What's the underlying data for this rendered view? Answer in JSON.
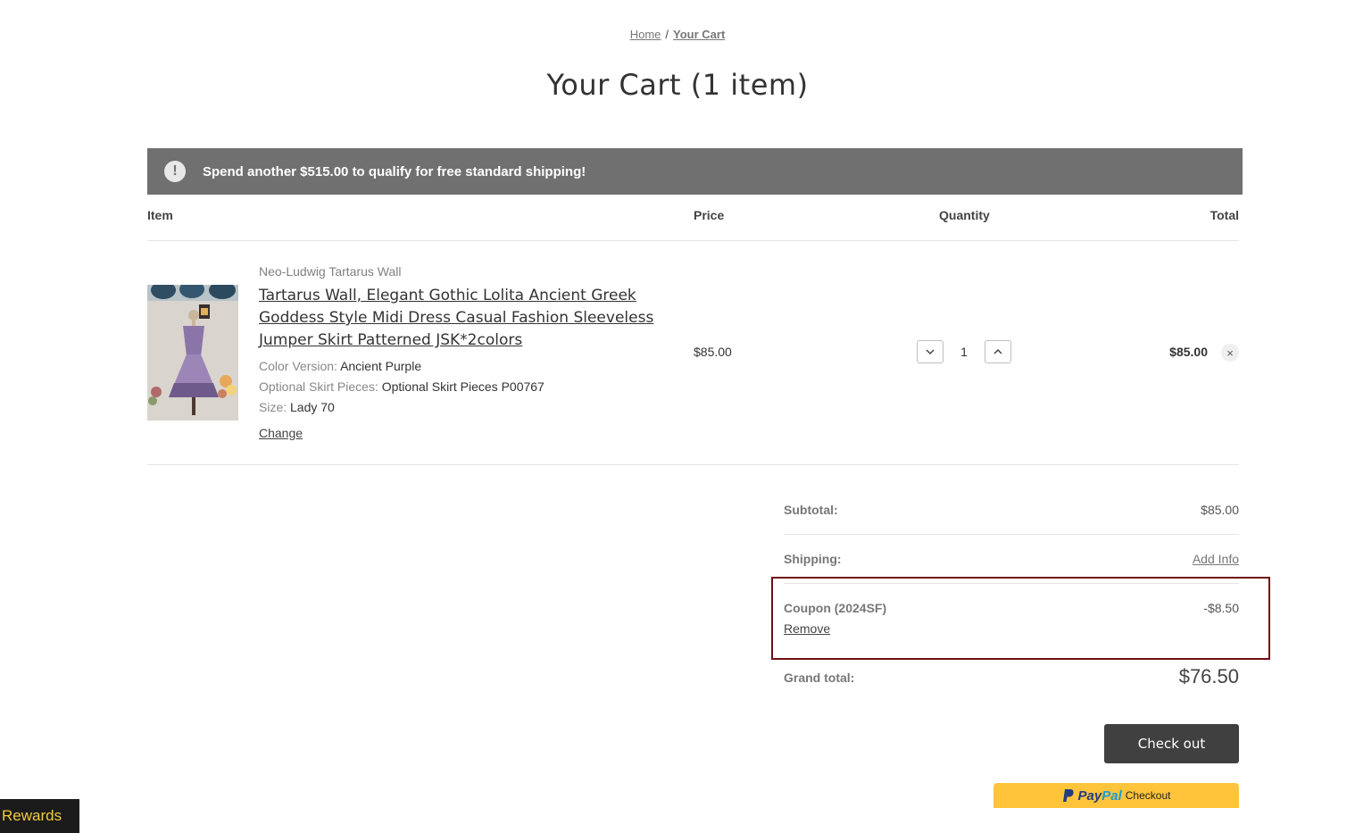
{
  "breadcrumb": {
    "home": "Home",
    "separator": "/",
    "current": "Your Cart"
  },
  "page_title": "Your Cart (1 item)",
  "notice": {
    "icon": "alert-circle-icon",
    "icon_glyph": "!",
    "message": "Spend another $515.00 to qualify for free standard shipping!"
  },
  "table_headers": {
    "item": "Item",
    "price": "Price",
    "quantity": "Quantity",
    "total": "Total"
  },
  "cart_item": {
    "vendor": "Neo-Ludwig Tartarus Wall",
    "title": "Tartarus Wall, Elegant Gothic Lolita Ancient Greek Goddess Style Midi Dress Casual Fashion Sleeveless Jumper Skirt Patterned JSK*2colors",
    "options": [
      {
        "key": "Color Version:",
        "value": "Ancient Purple"
      },
      {
        "key": "Optional Skirt Pieces:",
        "value": "Optional Skirt Pieces P00767"
      },
      {
        "key": "Size:",
        "value": "Lady 70"
      }
    ],
    "change_label": "Change",
    "price": "$85.00",
    "quantity": "1",
    "total": "$85.00",
    "remove_glyph": "×"
  },
  "summary": {
    "subtotal_label": "Subtotal:",
    "subtotal_value": "$85.00",
    "shipping_label": "Shipping:",
    "shipping_value": "Add Info",
    "coupon_label": "Coupon (2024SF)",
    "coupon_value": "-$8.50",
    "coupon_remove": "Remove",
    "grand_total_label": "Grand total:",
    "grand_total_value": "$76.50"
  },
  "checkout_label": "Check out",
  "paypal": {
    "brand_part1": "Pay",
    "brand_part2": "Pal",
    "label": "Checkout"
  },
  "rewards_label": "Rewards",
  "colors": {
    "notice_bg": "#707070",
    "checkout_bg": "#404040",
    "paypal_bg": "#ffc43a",
    "highlight_border": "#6e1015",
    "rewards_text": "#f5c842"
  }
}
